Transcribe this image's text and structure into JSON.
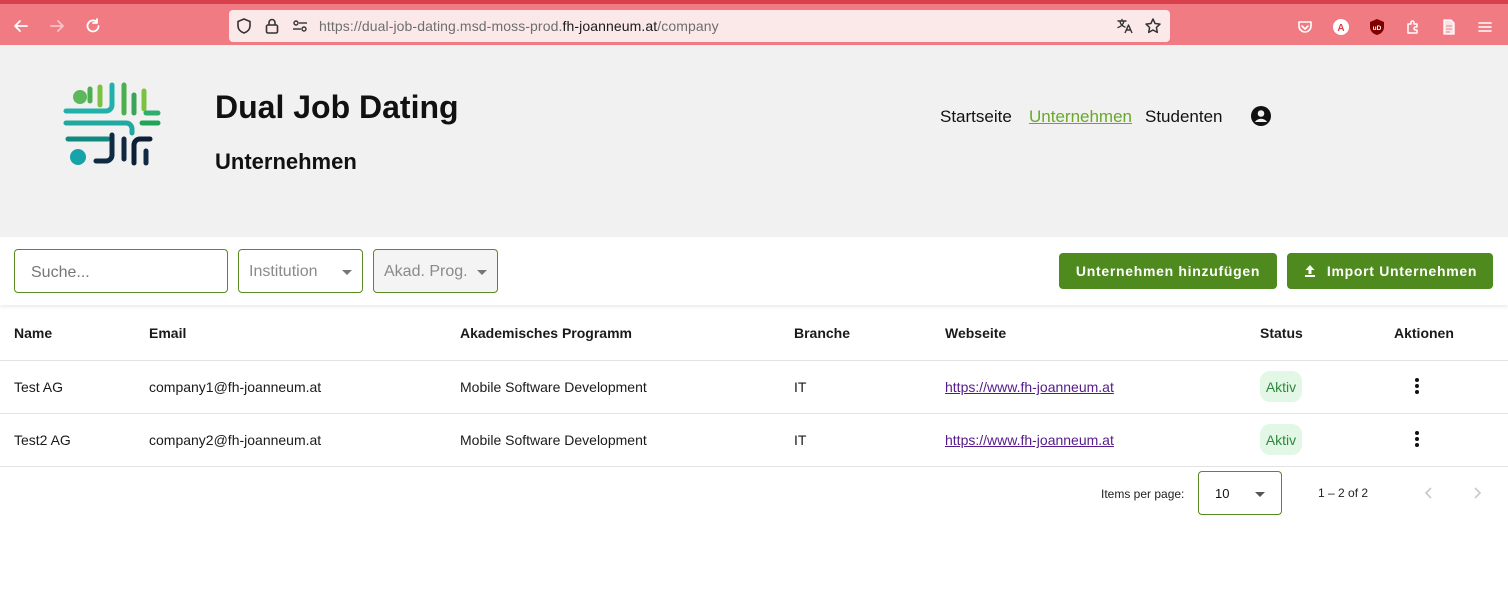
{
  "browser": {
    "url_prefix": "https://dual-job-dating.msd-moss-prod.",
    "url_domain": "fh-joanneum.at",
    "url_path": "/company",
    "colors": {
      "chrome": "#f07b83",
      "urlbar": "#fbe9ea"
    }
  },
  "header": {
    "app_title": "Dual Job Dating",
    "page_title": "Unternehmen",
    "nav": {
      "home": "Startseite",
      "companies": "Unternehmen",
      "students": "Studenten"
    }
  },
  "filters": {
    "search_placeholder": "Suche...",
    "institution_placeholder": "Institution",
    "program_placeholder": "Akad. Prog.",
    "add_button": "Unternehmen hinzufügen",
    "import_button": "Import Unternehmen"
  },
  "table": {
    "columns": {
      "name": "Name",
      "email": "Email",
      "program": "Akademisches Programm",
      "branch": "Branche",
      "website": "Webseite",
      "status": "Status",
      "actions": "Aktionen"
    },
    "rows": [
      {
        "name": "Test AG",
        "email": "company1@fh-joanneum.at",
        "program": "Mobile Software Development",
        "branch": "IT",
        "website": "https://www.fh-joanneum.at",
        "status": "Aktiv"
      },
      {
        "name": "Test2 AG",
        "email": "company2@fh-joanneum.at",
        "program": "Mobile Software Development",
        "branch": "IT",
        "website": "https://www.fh-joanneum.at",
        "status": "Aktiv"
      }
    ]
  },
  "paginator": {
    "items_per_page_label": "Items per page:",
    "items_per_page_value": "10",
    "range_label": "1 – 2 of 2"
  },
  "colors": {
    "accent_green": "#4f8a1e",
    "active_nav": "#6aa82b",
    "status_bg": "#e3f7e6",
    "status_text": "#2e8a3a",
    "header_bg": "#f1f1f1"
  },
  "icons": {
    "back": "arrow-left-icon",
    "forward": "arrow-right-icon",
    "reload": "reload-icon",
    "shield": "shield-icon",
    "lock": "lock-icon",
    "permissions": "permissions-icon",
    "translate": "translate-icon",
    "bookmark": "star-icon",
    "pocket": "pocket-icon",
    "account_ext": "account-extension-icon",
    "ublock": "ublock-icon",
    "extensions": "puzzle-icon",
    "reader": "page-icon",
    "menu": "hamburger-menu-icon",
    "account": "account-circle-icon",
    "upload": "upload-icon",
    "more": "more-vert-icon"
  }
}
